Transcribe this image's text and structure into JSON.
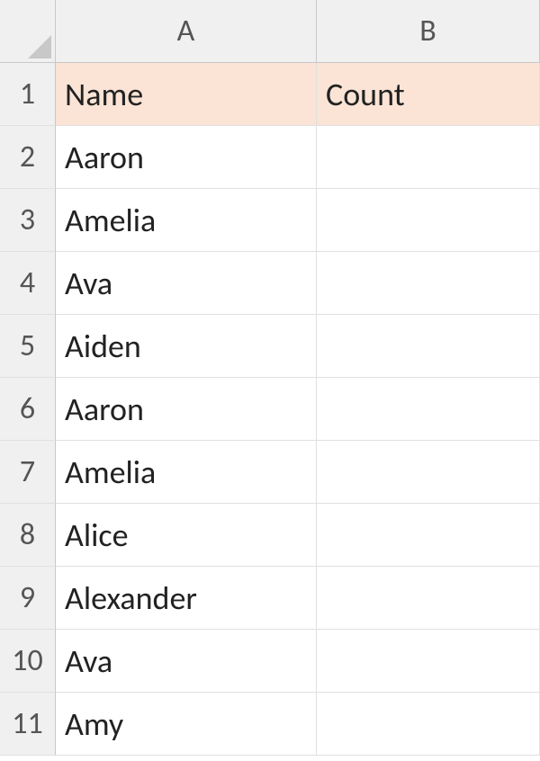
{
  "columns": [
    "A",
    "B"
  ],
  "rows": [
    {
      "num": "1",
      "a": "Name",
      "b": "Count",
      "header": true
    },
    {
      "num": "2",
      "a": "Aaron",
      "b": ""
    },
    {
      "num": "3",
      "a": "Amelia",
      "b": ""
    },
    {
      "num": "4",
      "a": "Ava",
      "b": ""
    },
    {
      "num": "5",
      "a": "Aiden",
      "b": ""
    },
    {
      "num": "6",
      "a": "Aaron",
      "b": ""
    },
    {
      "num": "7",
      "a": "Amelia",
      "b": ""
    },
    {
      "num": "8",
      "a": "Alice",
      "b": ""
    },
    {
      "num": "9",
      "a": "Alexander",
      "b": ""
    },
    {
      "num": "10",
      "a": "Ava",
      "b": ""
    },
    {
      "num": "11",
      "a": "Amy",
      "b": ""
    }
  ]
}
